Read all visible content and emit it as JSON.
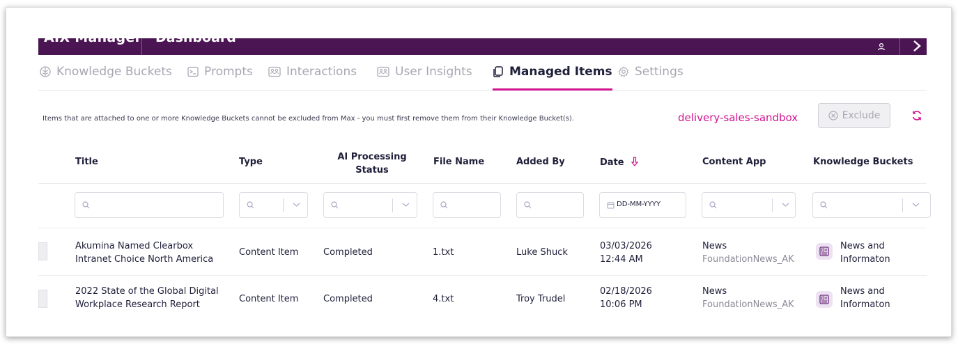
{
  "header": {
    "app_title": "AIX Manager",
    "dashboard_title": "Dashboard"
  },
  "tabs": [
    {
      "label": "Knowledge Buckets",
      "icon": "brain-icon",
      "active": false
    },
    {
      "label": "Prompts",
      "icon": "terminal-icon",
      "active": false
    },
    {
      "label": "Interactions",
      "icon": "users-card-icon",
      "active": false
    },
    {
      "label": "User Insights",
      "icon": "users-card-icon",
      "active": false
    },
    {
      "label": "Managed Items",
      "icon": "copy-icon",
      "active": true
    },
    {
      "label": "Settings",
      "icon": "gear-icon",
      "active": false
    }
  ],
  "notice": "Items that are attached to one or more Knowledge Buckets cannot be excluded from Max - you must first remove them from their Knowledge Bucket(s).",
  "environment": "delivery-sales-sandbox",
  "exclude_label": "Exclude",
  "table": {
    "columns": {
      "title": "Title",
      "type": "Type",
      "ai_status": "AI Processing Status",
      "file_name": "File Name",
      "added_by": "Added By",
      "date": "Date",
      "content_app": "Content App",
      "knowledge_buckets": "Knowledge Buckets"
    },
    "date_placeholder": "DD-MM-YYYY",
    "rows": [
      {
        "title_line1": "Akumina Named Clearbox",
        "title_line2": "Intranet Choice North America",
        "type": "Content Item",
        "status": "Completed",
        "file": "1.txt",
        "added_by": "Luke Shuck",
        "date": "03/03/2026",
        "time": "12:44 AM",
        "app": "News",
        "app_sub": "FoundationNews_AK",
        "kb_line1": "News and",
        "kb_line2": "Informaton"
      },
      {
        "title_line1": "2022 State of the Global Digital",
        "title_line2": "Workplace Research Report",
        "type": "Content Item",
        "status": "Completed",
        "file": "4.txt",
        "added_by": "Troy Trudel",
        "date": "02/18/2026",
        "time": "10:06 PM",
        "app": "News",
        "app_sub": "FoundationNews_AK",
        "kb_line1": "News and",
        "kb_line2": "Informaton"
      }
    ]
  },
  "colors": {
    "header_bg": "#4a1552",
    "accent": "#d0138f",
    "muted_text": "#a7a7b3"
  }
}
